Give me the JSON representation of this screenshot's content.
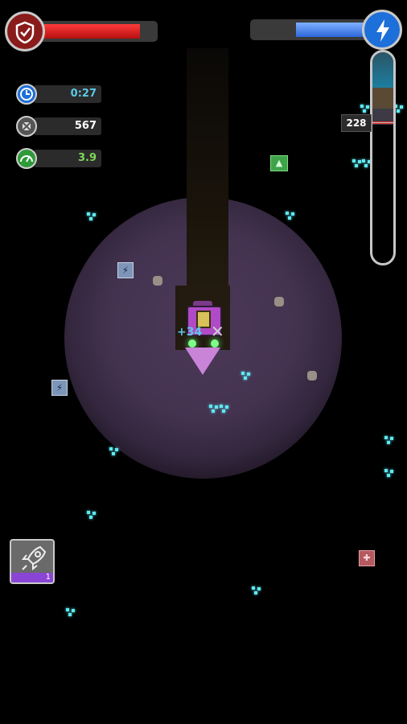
{
  "hud": {
    "health": {
      "icon": "shield-check-icon",
      "level": 0.85,
      "color": "#e02020"
    },
    "energy": {
      "icon": "lightning-icon",
      "level": 0.62,
      "color": "#3a78e6"
    },
    "stats": [
      {
        "icon": "clock-icon",
        "value": "0:27",
        "color": "#5cc9e6"
      },
      {
        "icon": "ore-icon",
        "value": "567",
        "color": "#ffffff"
      },
      {
        "icon": "speedometer-icon",
        "value": "3.9",
        "color": "#7ed957"
      }
    ],
    "depth": {
      "value": "228"
    }
  },
  "world": {
    "score_popup": "+34",
    "close_mark": "✕"
  },
  "boost": {
    "icon": "rocket-icon",
    "count": "1"
  }
}
